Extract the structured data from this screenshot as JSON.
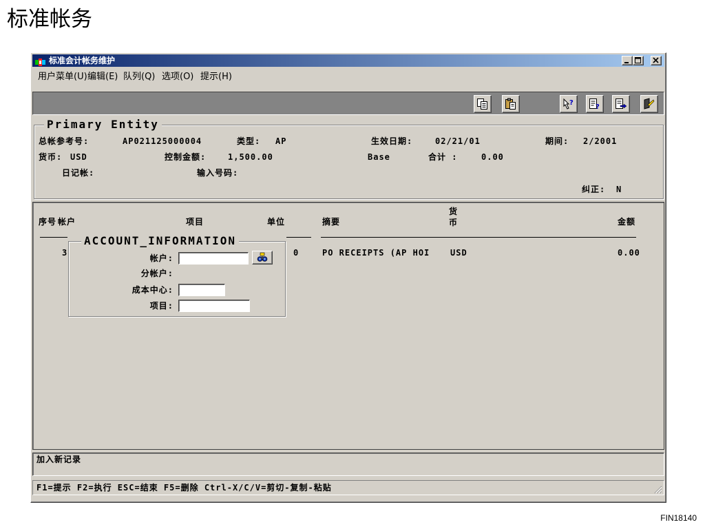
{
  "page": {
    "heading": "标准帐务",
    "figure_code": "FIN18140"
  },
  "window": {
    "title": "标准会计帐务维护",
    "app_icon": "app-icon",
    "controls": [
      "minimize-icon",
      "maximize-icon",
      "close-icon"
    ]
  },
  "menu": {
    "items": [
      {
        "label": "用户菜单(U)"
      },
      {
        "label": "编辑(E)"
      },
      {
        "label": "队列(Q)"
      },
      {
        "label": "选项(O)"
      },
      {
        "label": "提示(H)"
      }
    ]
  },
  "toolbar": {
    "buttons": [
      {
        "icon": "copy-icon"
      },
      {
        "icon": "paste-icon"
      },
      {
        "icon": "field-hint-icon"
      },
      {
        "icon": "record-hint-icon"
      },
      {
        "icon": "export-icon"
      },
      {
        "icon": "exit-icon"
      }
    ]
  },
  "primary_entity": {
    "legend": "Primary Entity",
    "gl_ref_label": "总帐参考号:",
    "gl_ref_value": "AP021125000004",
    "type_label": "类型:",
    "type_value": "AP",
    "effective_date_label": "生效日期:",
    "effective_date_value": "02/21/01",
    "period_label": "期间:",
    "period_value": "2/2001",
    "currency_label": "货币:",
    "currency_value": "USD",
    "control_amount_label": "控制金额:",
    "control_amount_value": "1,500.00",
    "base_label": "Base",
    "total_label": "合计 :",
    "total_value": "0.00",
    "journal_label": "日记帐:",
    "input_number_label": "输入号码:",
    "correction_label": "纠正:",
    "correction_value": "N"
  },
  "table": {
    "headers": {
      "seq": "序号",
      "account": "帐户",
      "item": "项目",
      "unit": "单位",
      "summary": "摘要",
      "currency": "货币",
      "amount": "金额"
    },
    "rows": [
      {
        "seq": "3",
        "unit": "0",
        "summary": "PO RECEIPTS (AP HOI",
        "currency": "USD",
        "amount": "0.00"
      }
    ]
  },
  "account_info": {
    "legend": "ACCOUNT_INFORMATION",
    "account_label": "帐户:",
    "account_value": "",
    "sub_account_label": "分帐户:",
    "cost_center_label": "成本中心:",
    "cost_center_value": "",
    "item_label": "项目:",
    "item_value": "",
    "lookup_icon": "lookup-icon"
  },
  "status": {
    "message": "加入新记录"
  },
  "hint_bar": {
    "text": "F1=提示 F2=执行 ESC=结束 F5=删除 Ctrl-X/C/V=剪切-复制-粘贴"
  },
  "colors": {
    "window_face": "#d4d0c8",
    "title_start": "#0a246a",
    "title_end": "#a6caf0",
    "toolbar_band": "#848484"
  }
}
